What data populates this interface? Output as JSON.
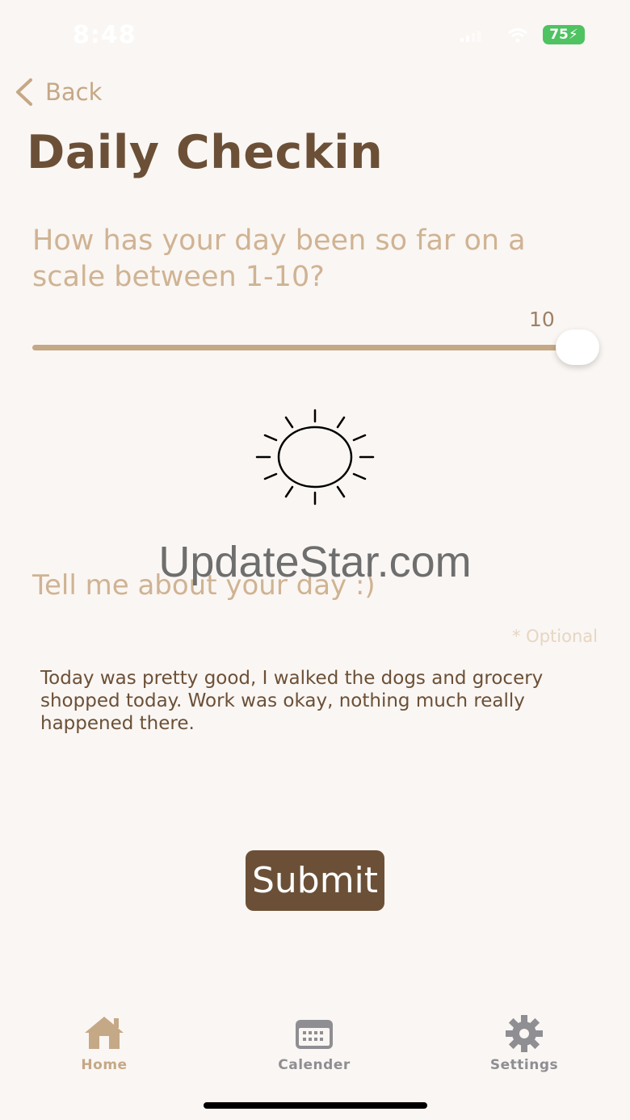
{
  "status_bar": {
    "time": "8:48",
    "battery": "75"
  },
  "nav": {
    "back_label": "Back"
  },
  "page": {
    "title": "Daily Checkin"
  },
  "question": {
    "text": "How has your day been so far on a scale between 1-10?"
  },
  "slider": {
    "value": "10",
    "min": 1,
    "max": 10
  },
  "mood_icon": "sun-icon",
  "watermark": "UpdateStar.com",
  "journal": {
    "prompt": "Tell me about your day :)",
    "optional_label": "* Optional",
    "text": "Today was pretty good, I walked the dogs and grocery shopped today. Work was okay, nothing much really happened there."
  },
  "submit_label": "Submit",
  "tabs": [
    {
      "label": "Home",
      "icon": "home-icon",
      "active": true
    },
    {
      "label": "Calender",
      "icon": "calendar-icon",
      "active": false
    },
    {
      "label": "Settings",
      "icon": "gear-icon",
      "active": false
    }
  ],
  "colors": {
    "background": "#faf6f3",
    "primary_brown": "#6b5037",
    "accent_tan": "#c5a886",
    "tab_inactive": "#8e8e93",
    "battery_green": "#4fc262"
  }
}
